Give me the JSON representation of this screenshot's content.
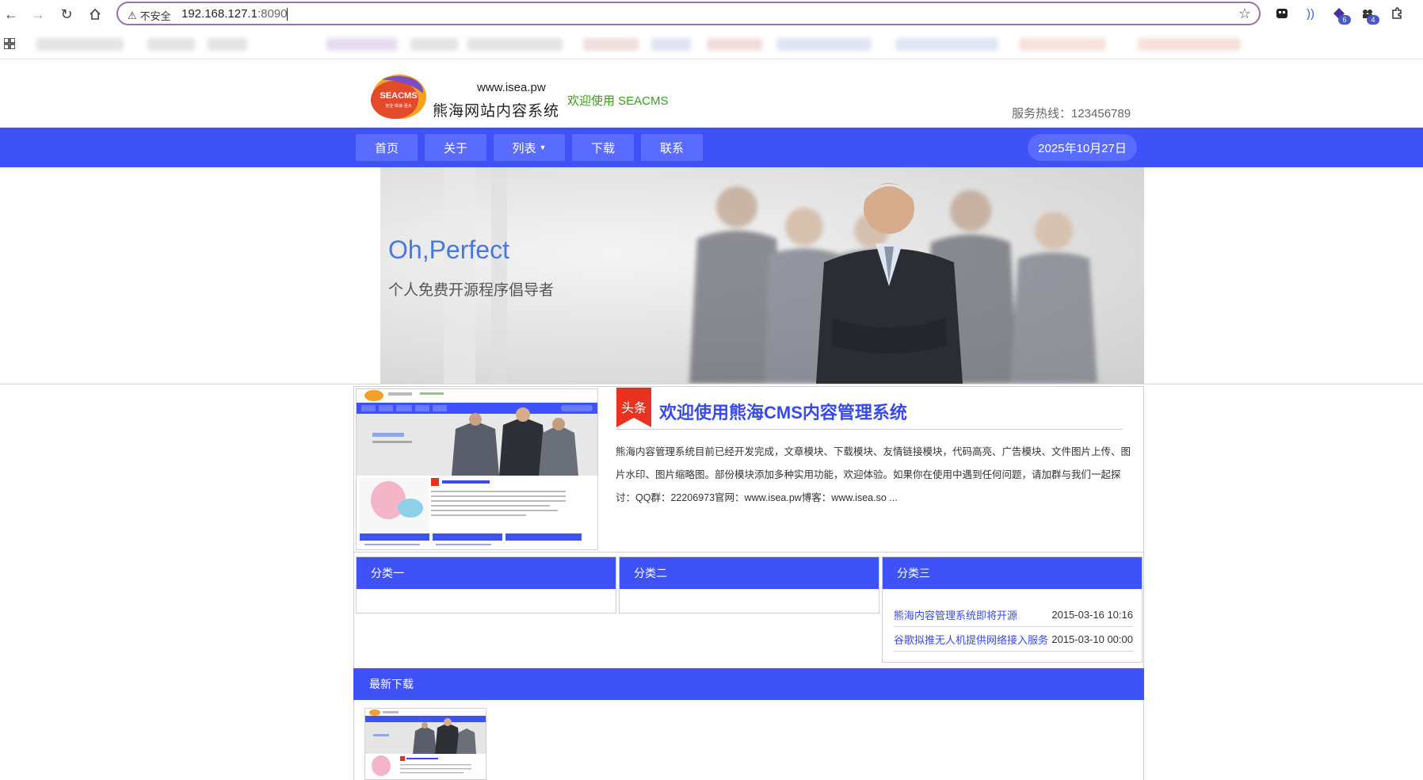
{
  "browser": {
    "security_label": "不安全",
    "url_host": "192.168.127.1",
    "url_port": ":8090",
    "extension_badges": [
      "6",
      "4"
    ]
  },
  "header": {
    "logo_text": "SEACMS",
    "logo_tagline": "安全·快速·强大",
    "site_url": "www.isea.pw",
    "site_name": "熊海网站内容系统",
    "welcome": "欢迎使用 SEACMS",
    "hotline": "服务热线：123456789"
  },
  "nav": {
    "items": [
      "首页",
      "关于",
      "列表",
      "下载",
      "联系"
    ],
    "date": "2025年10月27日"
  },
  "banner": {
    "slogan": "Oh,Perfect",
    "subtitle": "个人免费开源程序倡导者"
  },
  "headline": {
    "tag": "头条",
    "title": "欢迎使用熊海CMS内容管理系统",
    "description": "熊海内容管理系统目前已经开发完成，文章模块、下载模块、友情链接模块，代码高亮、广告模块、文件图片上传、图片水印、图片缩略图。部份模块添加多种实用功能，欢迎体验。如果你在使用中遇到任何问题，请加群与我们一起探讨：QQ群：22206973官网：www.isea.pw博客：www.isea.so ..."
  },
  "categories": [
    {
      "title": "分类一",
      "items": []
    },
    {
      "title": "分类二",
      "items": []
    },
    {
      "title": "分类三",
      "items": [
        {
          "title": "熊海内容管理系统即将开源",
          "time": "2015-03-16 10:16"
        },
        {
          "title": "谷歌拟推无人机提供网络接入服务",
          "time": "2015-03-10 00:00"
        }
      ]
    }
  ],
  "downloads": {
    "title": "最新下载"
  },
  "colors": {
    "primary": "#3f52f8",
    "nav_button": "#5a6cff",
    "welcome_green": "#3d9a1e",
    "tag_red": "#e8321f",
    "link_blue": "#3849f0"
  }
}
